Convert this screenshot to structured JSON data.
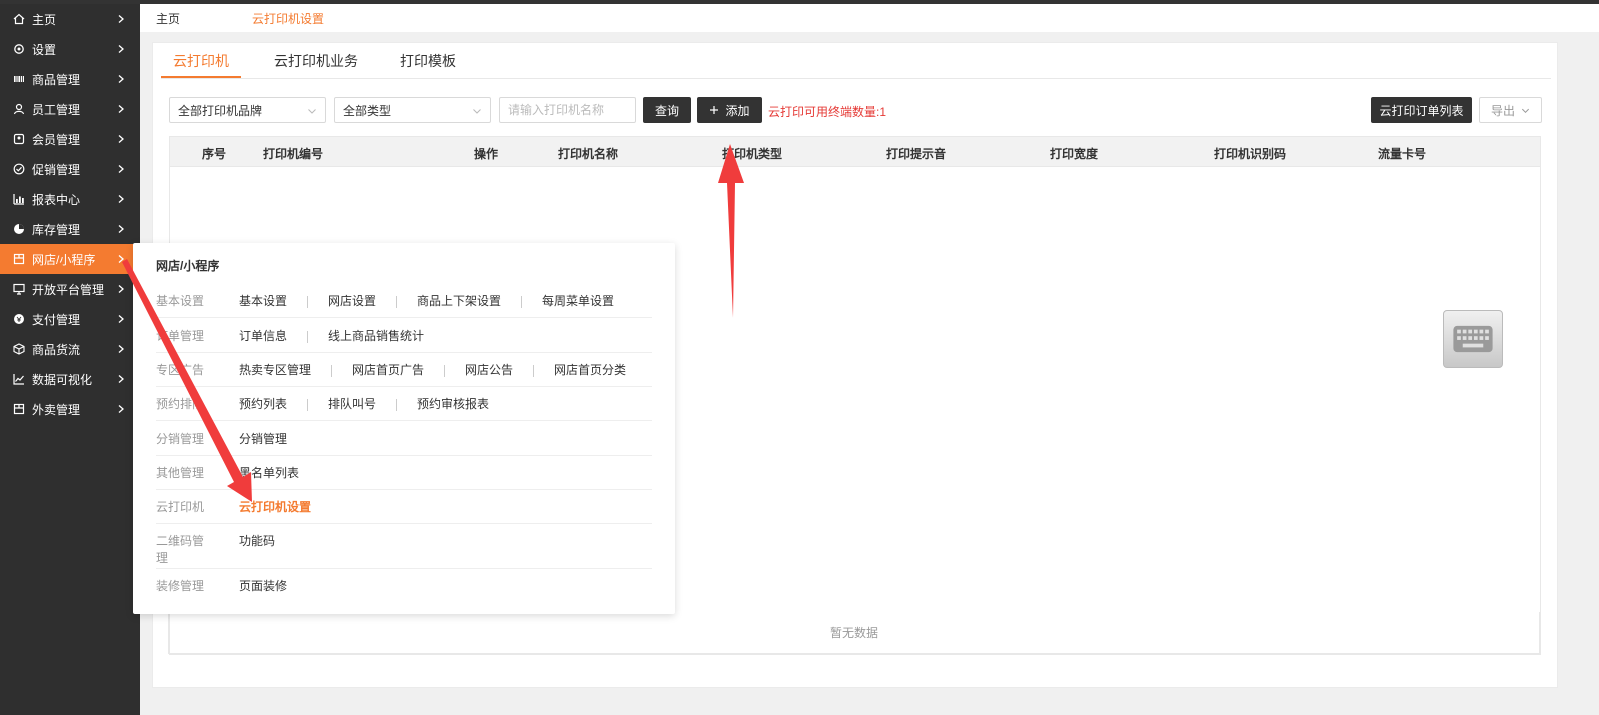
{
  "sidebar": {
    "items": [
      {
        "label": "主页",
        "icon": "home-icon"
      },
      {
        "label": "设置",
        "icon": "gear-icon"
      },
      {
        "label": "商品管理",
        "icon": "barcode-icon"
      },
      {
        "label": "员工管理",
        "icon": "user-icon"
      },
      {
        "label": "会员管理",
        "icon": "member-icon"
      },
      {
        "label": "促销管理",
        "icon": "check-circle-icon"
      },
      {
        "label": "报表中心",
        "icon": "bar-chart-icon"
      },
      {
        "label": "库存管理",
        "icon": "pie-chart-icon"
      },
      {
        "label": "网店/小程序",
        "icon": "store-icon"
      },
      {
        "label": "开放平台管理",
        "icon": "monitor-icon"
      },
      {
        "label": "支付管理",
        "icon": "coin-icon"
      },
      {
        "label": "商品货流",
        "icon": "cube-icon"
      },
      {
        "label": "数据可视化",
        "icon": "line-chart-icon"
      },
      {
        "label": "外卖管理",
        "icon": "store-icon"
      }
    ]
  },
  "breadcrumb": {
    "home": "主页",
    "current": "云打印机设置"
  },
  "tabs": [
    {
      "label": "云打印机"
    },
    {
      "label": "云打印机业务"
    },
    {
      "label": "打印模板"
    }
  ],
  "toolbar": {
    "brand_select": "全部打印机品牌",
    "type_select": "全部类型",
    "name_placeholder": "请输入打印机名称",
    "query_label": "查询",
    "add_label": "添加",
    "notice": "云打印可用终端数量:1",
    "order_list_label": "云打印订单列表",
    "export_label": "导出"
  },
  "table": {
    "columns": [
      "序号",
      "打印机编号",
      "操作",
      "打印机名称",
      "打印机类型",
      "打印提示音",
      "打印宽度",
      "打印机识别码",
      "流量卡号"
    ],
    "empty_text": "暂无数据"
  },
  "dropdown": {
    "title": "网店/小程序",
    "rows": [
      {
        "label": "基本设置",
        "links": [
          "基本设置",
          "网店设置",
          "商品上下架设置",
          "每周菜单设置"
        ]
      },
      {
        "label": "订单管理",
        "links": [
          "订单信息",
          "线上商品销售统计"
        ]
      },
      {
        "label": "专区广告",
        "links": [
          "热卖专区管理",
          "网店首页广告",
          "网店公告",
          "网店首页分类"
        ]
      },
      {
        "label": "预约排队",
        "links": [
          "预约列表",
          "排队叫号",
          "预约审核报表"
        ]
      },
      {
        "label": "分销管理",
        "links": [
          "分销管理"
        ]
      },
      {
        "label": "其他管理",
        "links": [
          "黑名单列表"
        ]
      },
      {
        "label": "云打印机",
        "links": [
          "云打印机设置"
        ]
      },
      {
        "label": "二维码管理",
        "links": [
          "功能码"
        ]
      },
      {
        "label": "装修管理",
        "links": [
          "页面装修"
        ]
      }
    ]
  },
  "colors": {
    "accent": "#f47b30",
    "sidebar_bg": "#2f2f2f",
    "annotation": "#f03c3c",
    "notice": "#e53935"
  }
}
